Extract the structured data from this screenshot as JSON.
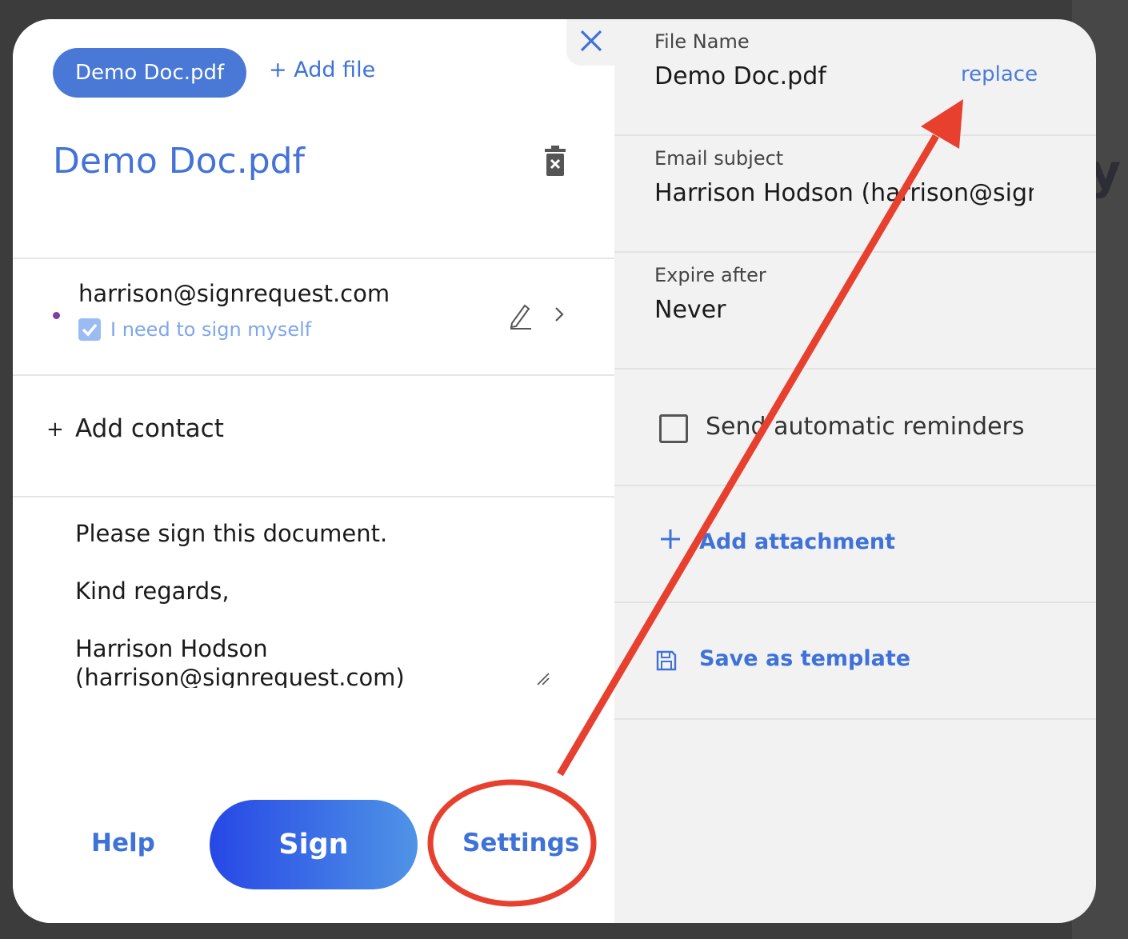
{
  "document": {
    "file_pill": "Demo Doc.pdf",
    "add_file_label": "+ Add file",
    "title": "Demo Doc.pdf"
  },
  "signer": {
    "email": "harrison@signrequest.com",
    "self_sign_label": "I need to sign myself",
    "self_sign_checked": true
  },
  "add_contact": {
    "plus": "+",
    "label": "Add contact"
  },
  "message": {
    "line1": "Please sign this document.",
    "line2": "Kind regards,",
    "line3": "Harrison Hodson",
    "line4": "(harrison@signrequest.com)"
  },
  "footer": {
    "help_label": "Help",
    "sign_label": "Sign",
    "settings_label": "Settings"
  },
  "settings": {
    "file_name_label": "File Name",
    "file_name_value": "Demo Doc.pdf",
    "replace_label": "replace",
    "email_subject_label": "Email subject",
    "email_subject_value": "Harrison Hodson (harrison@signrequest.com)",
    "expire_label": "Expire after",
    "expire_value": "Never",
    "reminders_label": "Send automatic reminders",
    "reminders_checked": false,
    "add_attachment_label": "Add attachment",
    "save_template_label": "Save as template"
  },
  "colors": {
    "accent": "#3f72d8",
    "pill": "#4a78d6",
    "annotation": "#e8402f"
  }
}
